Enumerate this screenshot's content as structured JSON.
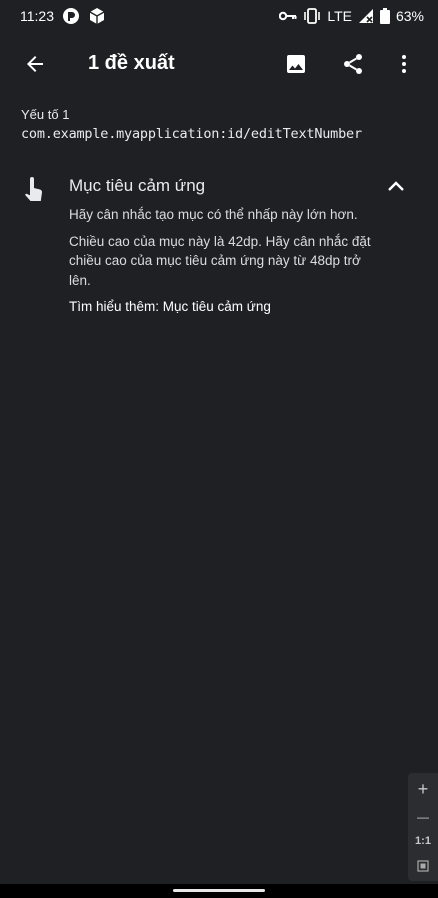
{
  "status_bar": {
    "time": "11:23",
    "network": "LTE",
    "battery": "63%",
    "icons": [
      "notification-app-icon",
      "package-icon",
      "vpn-key-icon",
      "vibrate-icon",
      "signal-icon",
      "battery-icon"
    ]
  },
  "app_bar": {
    "title": "1 đề xuất",
    "icons": [
      "back-arrow-icon",
      "image-icon",
      "share-icon",
      "more-vert-icon"
    ]
  },
  "element": {
    "label": "Yếu tố 1",
    "id": "com.example.myapplication:id/editTextNumber"
  },
  "suggestion": {
    "title": "Mục tiêu cảm ứng",
    "icon": "touch-target-icon",
    "paragraph1": "Hãy cân nhắc tạo mục có thể nhấp này lớn hơn.",
    "paragraph2": "Chiều cao của mục này là 42dp. Hãy cân nhắc đặt chiều cao của mục tiêu cảm ứng này từ 48dp trở lên.",
    "learn_more": "Tìm hiểu thêm: Mục tiêu cảm ứng"
  },
  "zoom_panel": {
    "zoom_in": "+",
    "zoom_out": "—",
    "one_to_one": "1:1"
  },
  "colors": {
    "background": "#1f2023",
    "text": "#e8eaed",
    "nav_bar": "#000000"
  }
}
